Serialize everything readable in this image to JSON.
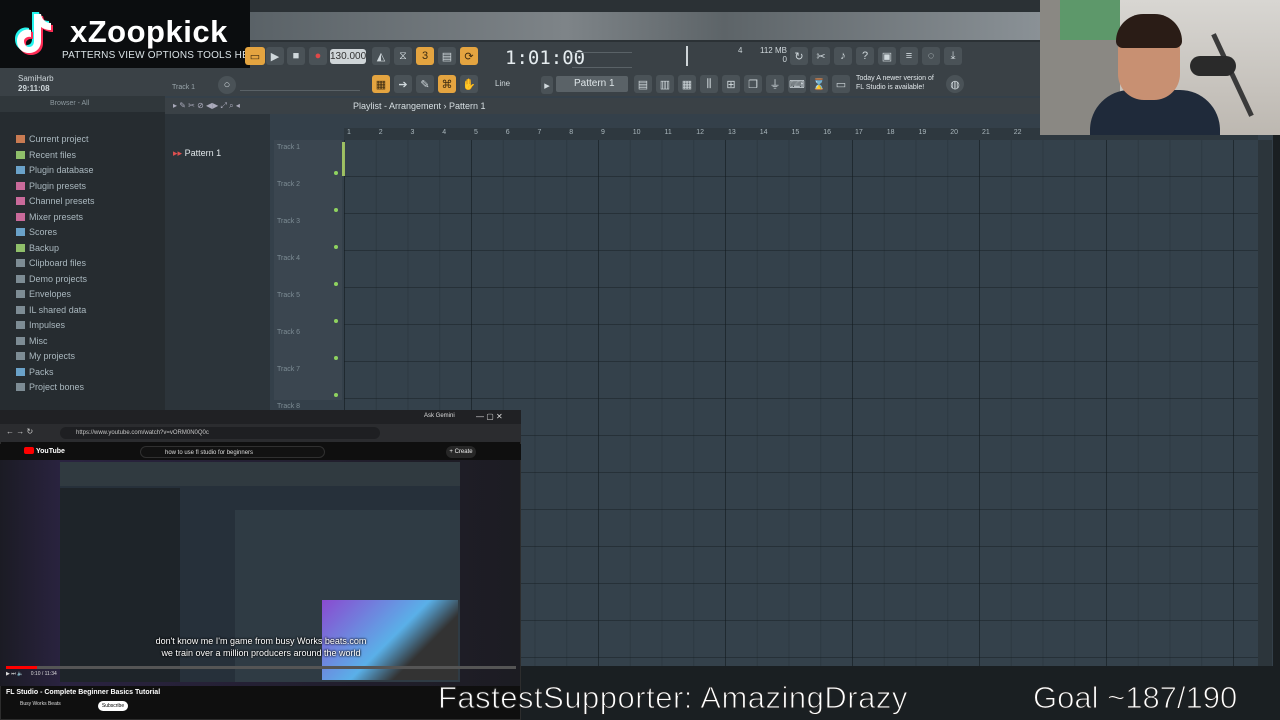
{
  "stream": {
    "channel_name": "xZoopkick",
    "ticker": "FastestSupporter: AmazingDrazy",
    "goal": "Goal ~187/190"
  },
  "fl": {
    "menu": "PATTERNS VIEW OPTIONS TOOLS HELP",
    "user": "SamiHarb",
    "elapsed": "29:11:08",
    "hint_track": "Track 1",
    "bpm": "130.000",
    "song_time": "1:01:00",
    "mem_top": "112 MB",
    "mem_bottom": "0",
    "mem_cpu": "4",
    "snap": "Line",
    "pattern_selector": "Pattern 1",
    "news_line1": "Today  A newer version of",
    "news_line2": "FL Studio is available!",
    "colors": {
      "accent": "#e4a440",
      "grid_bg": "#34414b",
      "playhead": "#b9e06a"
    }
  },
  "browser": {
    "header": "Browser - All",
    "items": [
      {
        "label": "Current project",
        "icon": "project-icon",
        "color": "#c97b52"
      },
      {
        "label": "Recent files",
        "icon": "folder-icon",
        "color": "#8fbf6a"
      },
      {
        "label": "Plugin database",
        "icon": "plugin-icon",
        "color": "#6aa2c9"
      },
      {
        "label": "Plugin presets",
        "icon": "plugin-icon",
        "color": "#c96a9a"
      },
      {
        "label": "Channel presets",
        "icon": "plugin-icon",
        "color": "#c96a9a"
      },
      {
        "label": "Mixer presets",
        "icon": "mixer-icon",
        "color": "#c96a9a"
      },
      {
        "label": "Scores",
        "icon": "score-icon",
        "color": "#6aa2c9"
      },
      {
        "label": "Backup",
        "icon": "folder-icon",
        "color": "#8fbf6a"
      },
      {
        "label": "Clipboard files",
        "icon": "folder-icon",
        "color": "#7d8c94"
      },
      {
        "label": "Demo projects",
        "icon": "folder-icon",
        "color": "#7d8c94"
      },
      {
        "label": "Envelopes",
        "icon": "folder-icon",
        "color": "#7d8c94"
      },
      {
        "label": "IL shared data",
        "icon": "folder-icon",
        "color": "#7d8c94"
      },
      {
        "label": "Impulses",
        "icon": "folder-icon",
        "color": "#7d8c94"
      },
      {
        "label": "Misc",
        "icon": "folder-icon",
        "color": "#7d8c94"
      },
      {
        "label": "My projects",
        "icon": "folder-icon",
        "color": "#7d8c94"
      },
      {
        "label": "Packs",
        "icon": "folder-icon",
        "color": "#6aa2c9"
      },
      {
        "label": "Project bones",
        "icon": "folder-icon",
        "color": "#7d8c94"
      }
    ]
  },
  "playlist": {
    "title": "Playlist - Arrangement › Pattern 1",
    "picker_pattern": "Pattern 1",
    "tracks": [
      "Track 1",
      "Track 2",
      "Track 3",
      "Track 4",
      "Track 5",
      "Track 6",
      "Track 7",
      "Track 8"
    ],
    "bars": [
      "1",
      "2",
      "3",
      "4",
      "5",
      "6",
      "7",
      "8",
      "9",
      "10",
      "11",
      "12",
      "13",
      "14",
      "15",
      "16",
      "17",
      "18",
      "19",
      "20",
      "21",
      "22"
    ]
  },
  "youtube": {
    "url": "https://www.youtube.com/watch?v=vORM0N0Q0c",
    "gemini_tab": "Ask Gemini",
    "logo": "YouTube",
    "search": "how to use fl studio for beginners",
    "create": "+ Create",
    "caption_line1": "don't know me I'm game from busy Works beats.com",
    "caption_line2": "we train over a million producers around the world",
    "time": "0:10 / 11:34",
    "video_title": "FL Studio - Complete Beginner Basics Tutorial",
    "channel": "Busy Works Beats",
    "subscribe": "Subscribe",
    "progress": 0.06
  }
}
